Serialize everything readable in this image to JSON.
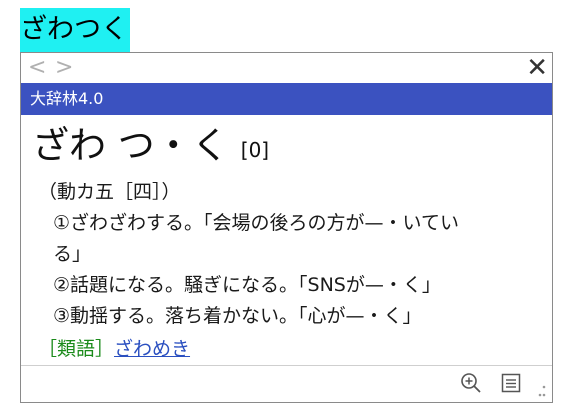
{
  "selected_word": "ざわつく",
  "popup": {
    "nav": {
      "back_icon": "chevron-left-icon",
      "forward_icon": "chevron-right-icon",
      "close_label": "✕"
    },
    "dictionary_name": "大辞林4.0",
    "entry": {
      "headword": "ざわ つ・く",
      "accent": "[0]",
      "part_of_speech": "（動カ五［四］）",
      "definitions": [
        "①ざわざわする。「会場の後ろの方が—・いてい",
        "る」",
        "②話題になる。騒ぎになる。「SNSが—・く」",
        "③動揺する。落ち着かない。「心が—・く」"
      ],
      "related_tag": "［類語］",
      "related_link": "ざわめき"
    },
    "toolbar": {
      "zoom_icon": "zoom-in-icon",
      "list_icon": "list-icon",
      "grip_icon": "resize-grip-icon"
    }
  },
  "colors": {
    "highlight": "#1ff0f2",
    "dict_bar": "#3b52c0",
    "related_tag": "#1a8a1a",
    "link": "#2a4fc0"
  }
}
